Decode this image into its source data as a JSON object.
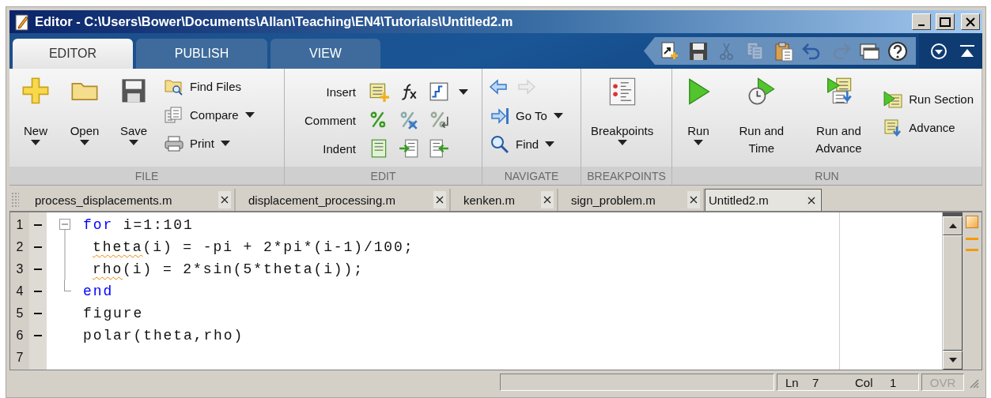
{
  "window": {
    "title": "Editor - C:\\Users\\Bower\\Documents\\Allan\\Teaching\\EN4\\Tutorials\\Untitled2.m"
  },
  "ribbon_tabs": [
    {
      "label": "EDITOR",
      "selected": true
    },
    {
      "label": "PUBLISH",
      "selected": false
    },
    {
      "label": "VIEW",
      "selected": false
    }
  ],
  "quick_access": [
    {
      "disabled": false
    },
    {
      "disabled": false
    },
    {
      "disabled": true
    },
    {
      "disabled": true
    },
    {
      "disabled": false
    },
    {
      "disabled": false
    },
    {
      "disabled": true
    },
    {
      "disabled": false
    },
    {
      "disabled": false
    }
  ],
  "ribbon_groups": [
    {
      "title": "FILE",
      "items": [
        {
          "kind": "large",
          "label": "New",
          "menu": true
        },
        {
          "kind": "large",
          "label": "Open",
          "menu": true
        },
        {
          "kind": "large",
          "label": "Save",
          "menu": true
        },
        {
          "kind": "stack",
          "items": [
            {
              "kind": "button",
              "label": "Find Files",
              "menu": false
            },
            {
              "kind": "button",
              "label": "Compare",
              "menu": true
            },
            {
              "kind": "button",
              "label": "Print",
              "menu": true
            }
          ]
        }
      ]
    },
    {
      "title": "EDIT",
      "items": [
        {
          "kind": "rows",
          "rows": [
            {
              "label": "Insert",
              "menu": true
            },
            {
              "label": "Comment",
              "menu": false
            },
            {
              "label": "Indent",
              "menu": false
            }
          ]
        }
      ]
    },
    {
      "title": "NAVIGATE",
      "items": [
        {
          "kind": "stack",
          "items": [
            {
              "kind": "arrows",
              "buttons": [
                {
                  "disabled": false
                },
                {
                  "disabled": true
                }
              ]
            },
            {
              "kind": "button",
              "label": "Go To",
              "menu": true
            },
            {
              "kind": "button",
              "label": "Find",
              "menu": true
            }
          ]
        }
      ]
    },
    {
      "title": "BREAKPOINTS",
      "items": [
        {
          "kind": "large",
          "label": "Breakpoints",
          "menu": true
        }
      ]
    },
    {
      "title": "RUN",
      "items": [
        {
          "kind": "large",
          "label": "Run",
          "menu": true
        },
        {
          "kind": "large",
          "label": "Run and Time",
          "menu": false
        },
        {
          "kind": "large",
          "label": "Run and Advance",
          "menu": false
        },
        {
          "kind": "stack",
          "items": [
            {
              "kind": "button",
              "label": "Run Section",
              "menu": false
            },
            {
              "kind": "button",
              "label": "Advance",
              "menu": false
            }
          ]
        }
      ]
    }
  ],
  "file_tabs": [
    {
      "label": "process_displacements.m",
      "selected": false
    },
    {
      "label": "displacement_processing.m",
      "selected": false
    },
    {
      "label": "kenken.m",
      "selected": false
    },
    {
      "label": "sign_problem.m",
      "selected": false
    },
    {
      "label": "Untitled2.m",
      "selected": true
    }
  ],
  "editor": {
    "lines": [
      {
        "number": "1",
        "executable": true,
        "kind": "fold_start",
        "tokens": [
          {
            "text": "for",
            "kind": "keyword"
          },
          {
            "text": " i=1:101",
            "kind": "plain"
          }
        ]
      },
      {
        "number": "2",
        "executable": true,
        "kind": "fold_body",
        "tokens": [
          {
            "text": "theta",
            "kind": "warning"
          },
          {
            "text": "(i) = -pi + 2*pi*(i-1)/100;",
            "kind": "plain"
          }
        ]
      },
      {
        "number": "3",
        "executable": true,
        "kind": "fold_body",
        "tokens": [
          {
            "text": "rho",
            "kind": "warning"
          },
          {
            "text": "(i) = 2*sin(5*theta(i));",
            "kind": "plain"
          }
        ]
      },
      {
        "number": "4",
        "executable": true,
        "kind": "fold_end",
        "tokens": [
          {
            "text": "end",
            "kind": "keyword"
          }
        ]
      },
      {
        "number": "5",
        "executable": true,
        "kind": "plain",
        "tokens": [
          {
            "text": "figure",
            "kind": "plain"
          }
        ]
      },
      {
        "number": "6",
        "executable": true,
        "kind": "plain",
        "tokens": [
          {
            "text": "polar(theta,rho)",
            "kind": "plain"
          }
        ]
      },
      {
        "number": "7",
        "executable": false,
        "kind": "plain"
      }
    ]
  },
  "status_bar": {
    "ln_label": "Ln",
    "ln": "7",
    "col_label": "Col",
    "col": "1",
    "ovr": {
      "label": "OVR",
      "disabled": true
    }
  }
}
